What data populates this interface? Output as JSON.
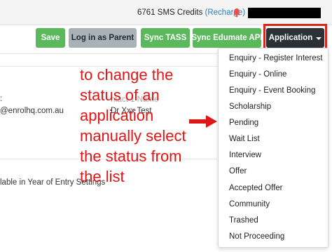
{
  "topbar": {
    "sms_credits": "6761 SMS Credits",
    "recharge": "(Recharge)",
    "bell_icon": "bell-icon",
    "redacted_color": "#000000"
  },
  "toolbar": {
    "save_label": "Save",
    "parent_label": "Log in as Parent",
    "tass_label": "Sync TASS",
    "edumate_label": "Sync Edumate API",
    "application_label": "Application"
  },
  "form": {
    "colon": ":",
    "email": "@enrolhq.com.au",
    "contact_label": "ntact 1 Name",
    "contact_name": "Dr Xxx Test",
    "year_of_entry": "lable in Year of Entry Settings"
  },
  "annotation": {
    "lines": [
      "to change the",
      "status of an",
      "application",
      "manually select",
      "the status from",
      "the list"
    ],
    "color": "#e01515"
  },
  "dropdown": {
    "items": [
      "Enquiry - Register Interest",
      "Enquiry - Online",
      "Enquiry - Event Booking",
      "Scholarship",
      "Pending",
      "Wait List",
      "Interview",
      "Offer",
      "Accepted Offer",
      "Community",
      "Trashed",
      "Not Proceeding"
    ]
  },
  "colors": {
    "success": "#5cb85c",
    "secondary": "#aab2b8",
    "dark": "#2b3137",
    "highlight": "#d9261c",
    "link": "#2a7fc1"
  }
}
